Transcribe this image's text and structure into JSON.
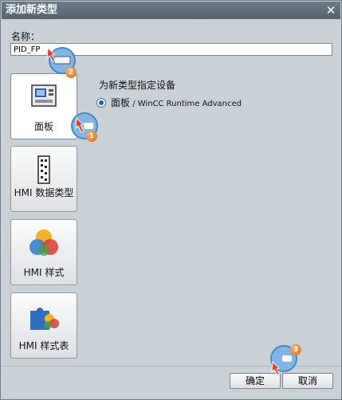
{
  "window": {
    "title": "添加新类型",
    "close_glyph": "✕"
  },
  "name_field": {
    "label": "名称：",
    "value": "PID_FP"
  },
  "categories": [
    {
      "label": "面板",
      "icon": "panel-icon",
      "selected": true
    },
    {
      "label": "HMI 数据类型",
      "icon": "hmi-datatype-icon",
      "selected": false
    },
    {
      "label": "HMI 样式",
      "icon": "hmi-style-icon",
      "selected": false
    },
    {
      "label": "HMI 样式表",
      "icon": "hmi-stylesheet-icon",
      "selected": false
    }
  ],
  "device": {
    "heading": "为新类型指定设备",
    "option_main": "面板",
    "option_sub": " / WinCC Runtime Advanced",
    "selected": true
  },
  "buttons": {
    "ok": "确定",
    "cancel": "取消"
  },
  "step_badges": [
    "1",
    "2",
    "3"
  ]
}
